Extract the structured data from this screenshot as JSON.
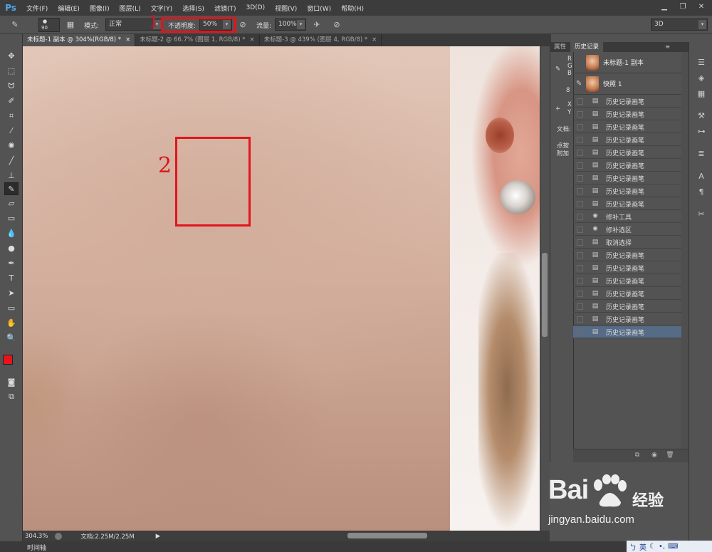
{
  "app": {
    "logo": "Ps"
  },
  "menu": [
    "文件(F)",
    "编辑(E)",
    "图像(I)",
    "图层(L)",
    "文字(Y)",
    "选择(S)",
    "滤镜(T)",
    "3D(D)",
    "视图(V)",
    "窗口(W)",
    "帮助(H)"
  ],
  "window_controls": {
    "minimize": "▁",
    "restore": "❐",
    "close": "✕"
  },
  "options": {
    "brush_size": "90",
    "mode_label": "模式:",
    "mode_value": "正常",
    "opacity_label": "不透明度:",
    "opacity_value": "50%",
    "flow_label": "流量:",
    "flow_value": "100%",
    "workspace": "3D"
  },
  "tabs": [
    {
      "label": "未标题-1 副本 @ 304%(RGB/8) *",
      "close": "×"
    },
    {
      "label": "未标题-2 @ 66.7% (图层 1, RGB/8) *",
      "close": "×"
    },
    {
      "label": "未标题-3 @ 439% (图层 4, RGB/8) *",
      "close": "×"
    }
  ],
  "annotations": {
    "label1": "1",
    "label2": "2"
  },
  "status": {
    "zoom": "304.3%",
    "doc": "文档:2.25M/2.25M"
  },
  "timeline": {
    "label": "时间轴"
  },
  "panel": {
    "tabs": [
      "属性",
      "历史记录"
    ],
    "props_partial": [
      "R",
      "G",
      "B",
      "8",
      "X",
      "Y",
      "文档:",
      "点按",
      "附加"
    ],
    "snapshots": [
      "未标题-1 副本",
      "快照 1"
    ],
    "history": [
      "历史记录画笔",
      "历史记录画笔",
      "历史记录画笔",
      "历史记录画笔",
      "历史记录画笔",
      "历史记录画笔",
      "历史记录画笔",
      "历史记录画笔",
      "历史记录画笔",
      "修补工具",
      "修补选区",
      "取消选择",
      "历史记录画笔",
      "历史记录画笔",
      "历史记录画笔",
      "历史记录画笔",
      "历史记录画笔",
      "历史记录画笔",
      "历史记录画笔"
    ],
    "selected_index": 18
  },
  "watermark": {
    "brand": "Bai",
    "brand2": "经验",
    "url": "jingyan.baidu.com"
  },
  "ime": {
    "lang": "英"
  },
  "colors": {
    "foreground": "#e8141c",
    "background": "#ffffff",
    "highlight": "#e2141c",
    "selected_row": "#566b86"
  }
}
